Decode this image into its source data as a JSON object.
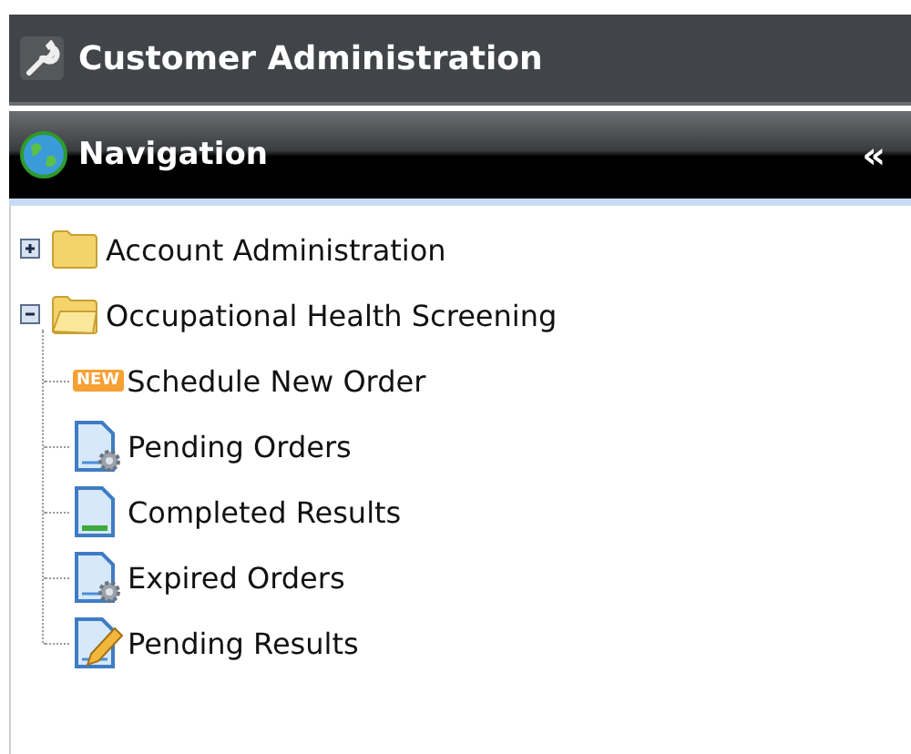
{
  "header": {
    "title": "Customer Administration"
  },
  "panel": {
    "title": "Navigation",
    "collapse": "«"
  },
  "tree": [
    {
      "label": "Account Administration",
      "expanded": false
    },
    {
      "label": "Occupational Health Screening",
      "expanded": true,
      "children": [
        {
          "label": "Schedule New Order",
          "kind": "new",
          "badge": "NEW"
        },
        {
          "label": "Pending Orders",
          "kind": "gear"
        },
        {
          "label": "Completed Results",
          "kind": "done"
        },
        {
          "label": "Expired Orders",
          "kind": "gear"
        },
        {
          "label": "Pending Results",
          "kind": "pencil"
        }
      ]
    }
  ]
}
